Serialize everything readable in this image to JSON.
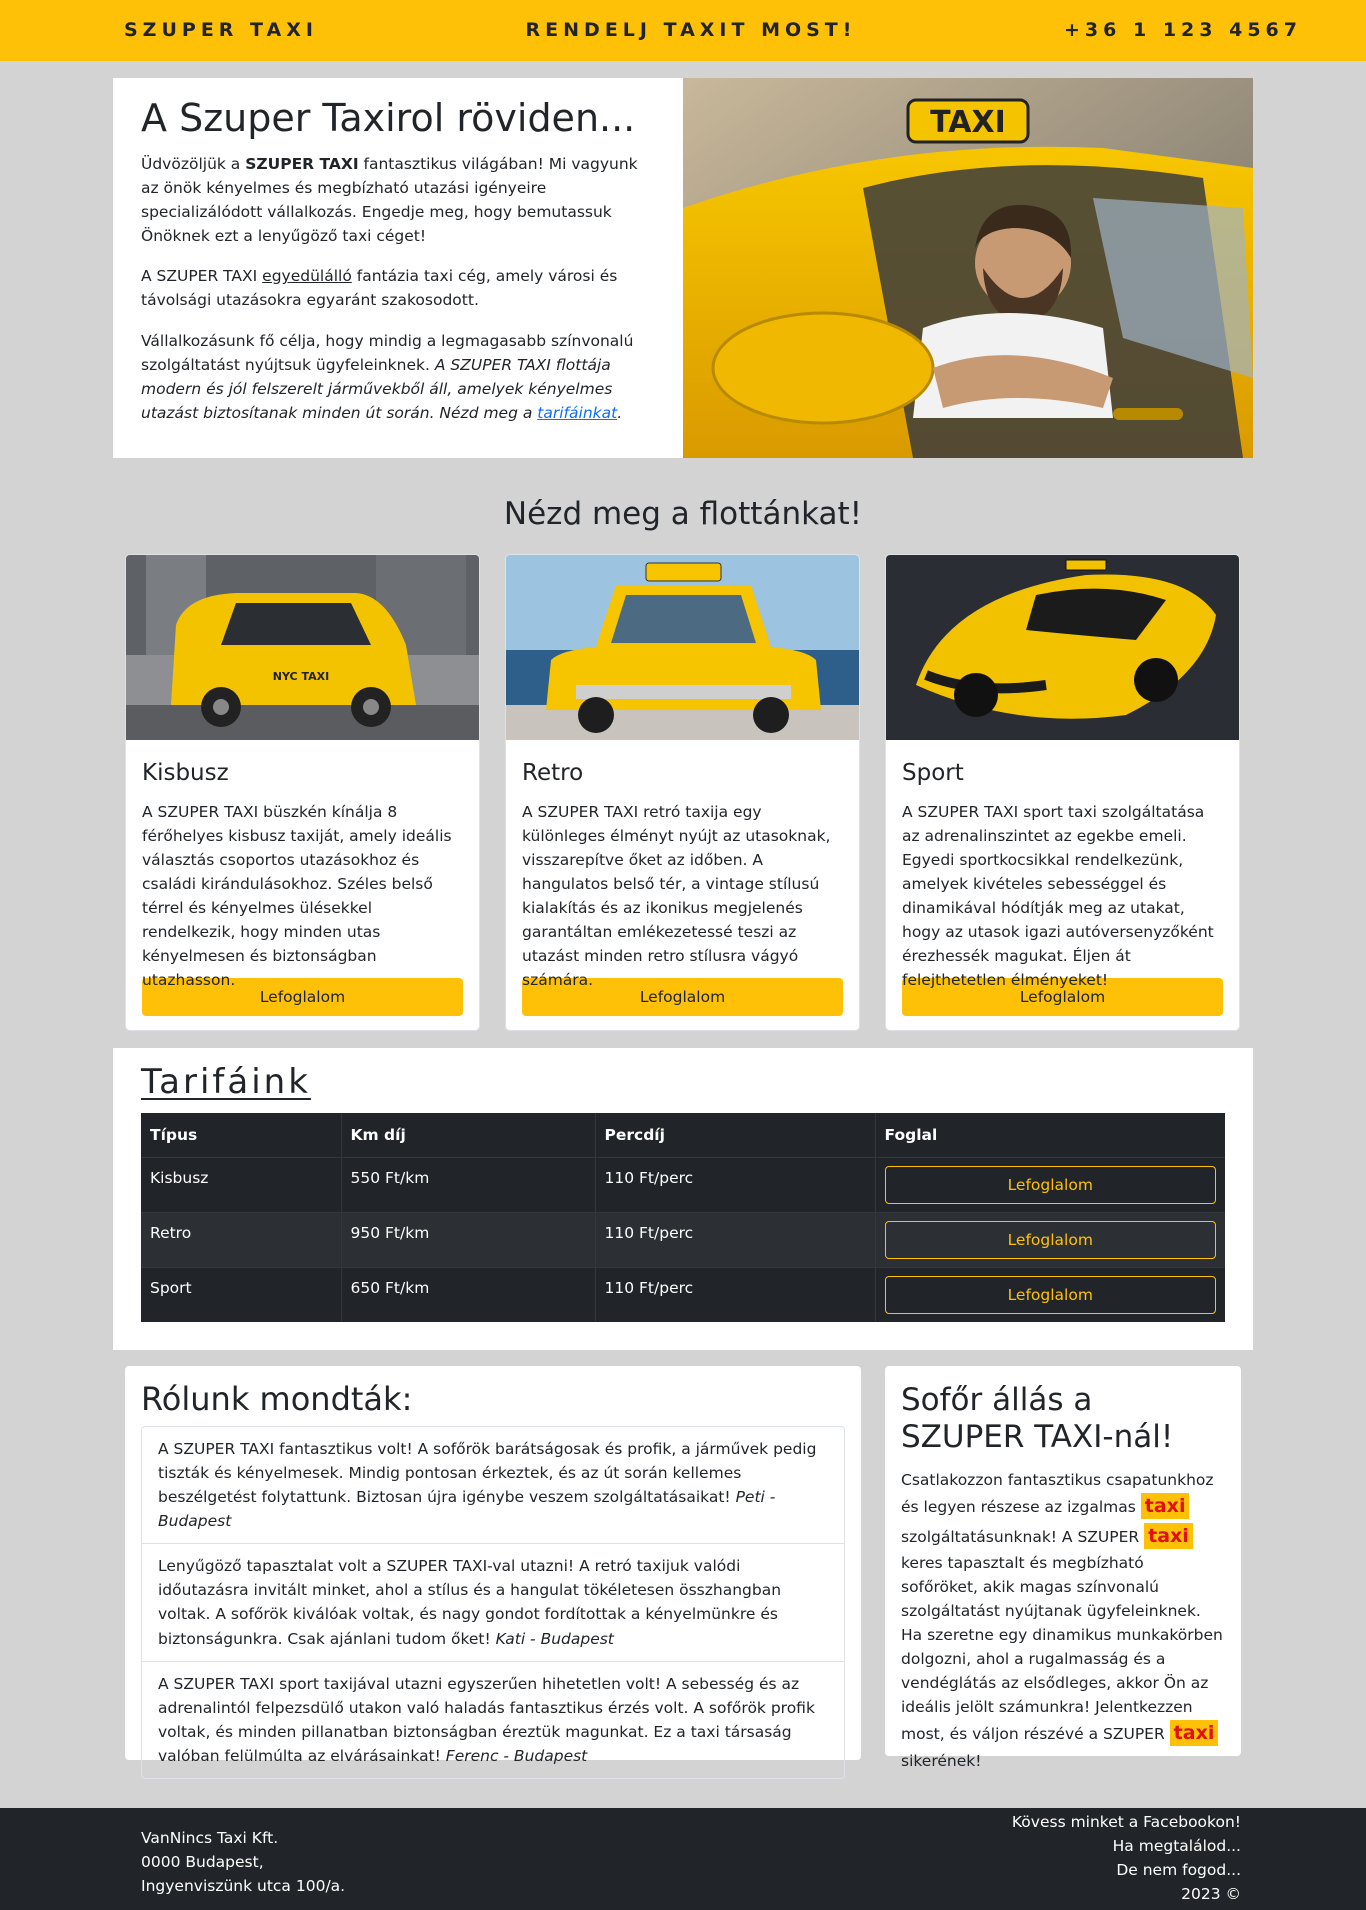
{
  "header": {
    "brand": "SZUPER TAXI",
    "cta": "RENDELJ TAXIT MOST!",
    "phone": "+36 1 123 4567"
  },
  "intro": {
    "title": "A Szuper Taxirol röviden...",
    "p1_a": "Üdvözöljük a ",
    "p1_b": "SZUPER TAXI",
    "p1_c": " fantasztikus világában! Mi vagyunk az önök kényelmes és megbízható utazási igényeire specializálódott vállalkozás. Engedje meg, hogy bemutassuk Önöknek ezt a lenyűgöző taxi céget!",
    "p2_a": "A SZUPER TAXI ",
    "p2_b": "egyedülálló",
    "p2_c": " fantázia taxi cég, amely városi és távolsági utazásokra egyaránt szakosodott.",
    "p3_a": "Vállalkozásunk fő célja, hogy mindig a legmagasabb színvonalú szolgáltatást nyújtsuk ügyfeleinknek. ",
    "p3_b": "A SZUPER TAXI flottája modern és jól felszerelt járművekből áll, amelyek kényelmes utazást biztosítanak minden út során. Nézd meg a ",
    "p3_link": "tarifáinkat",
    "p3_c": "."
  },
  "fleet_title": "Nézd meg a flottánkat!",
  "cards": [
    {
      "title": "Kisbusz",
      "text": "A SZUPER TAXI büszkén kínálja 8 férőhelyes kisbusz taxiját, amely ideális választás csoportos utazásokhoz és családi kirándulásokhoz. Széles belső térrel és kényelmes ülésekkel rendelkezik, hogy minden utas kényelmesen és biztonságban utazhasson.",
      "button": "Lefoglalom"
    },
    {
      "title": "Retro",
      "text": "A SZUPER TAXI retró taxija egy különleges élményt nyújt az utasoknak, visszarepítve őket az időben. A hangulatos belső tér, a vintage stílusú kialakítás és az ikonikus megjelenés garantáltan emlékezetessé teszi az utazást minden retro stílusra vágyó számára.",
      "button": "Lefoglalom"
    },
    {
      "title": "Sport",
      "text": "A SZUPER TAXI sport taxi szolgáltatása az adrenalinszintet az egekbe emeli. Egyedi sportkocsikkal rendelkezünk, amelyek kivételes sebességgel és dinamikával hódítják meg az utakat, hogy az utasok igazi autóversenyzőként érezhessék magukat. Éljen át felejthetetlen élményeket!",
      "button": "Lefoglalom"
    }
  ],
  "tariffs": {
    "title": "Tarifáink",
    "headers": [
      "Típus",
      "Km díj",
      "Percdíj",
      "Foglal"
    ],
    "rows": [
      {
        "type": "Kisbusz",
        "km": "550 Ft/km",
        "min": "110 Ft/perc",
        "button": "Lefoglalom"
      },
      {
        "type": "Retro",
        "km": "950 Ft/km",
        "min": "110 Ft/perc",
        "button": "Lefoglalom"
      },
      {
        "type": "Sport",
        "km": "650 Ft/km",
        "min": "110 Ft/perc",
        "button": "Lefoglalom"
      }
    ]
  },
  "reviews": {
    "title": "Rólunk mondták:",
    "items": [
      {
        "text": "A SZUPER TAXI fantasztikus volt! A sofőrök barátságosak és profik, a járművek pedig tiszták és kényelmesek. Mindig pontosan érkeztek, és az út során kellemes beszélgetést folytattunk. Biztosan újra igénybe veszem szolgáltatásaikat! ",
        "author": "Peti - Budapest"
      },
      {
        "text": "Lenyűgöző tapasztalat volt a SZUPER TAXI-val utazni! A retró taxijuk valódi időutazásra invitált minket, ahol a stílus és a hangulat tökéletesen összhangban voltak. A sofőrök kiválóak voltak, és nagy gondot fordítottak a kényelmünkre és biztonságunkra. Csak ajánlani tudom őket! ",
        "author": "Kati - Budapest"
      },
      {
        "text": "A SZUPER TAXI sport taxijával utazni egyszerűen hihetetlen volt! A sebesség és az adrenalintól felpezsdülő utakon való haladás fantasztikus érzés volt. A sofőrök profik voltak, és minden pillanatban biztonságban éreztük magunkat. Ez a taxi társaság valóban felülmúlta az elvárásainkat! ",
        "author": "Ferenc - Budapest"
      }
    ]
  },
  "job": {
    "title": "Sofőr állás a SZUPER TAXI-nál!",
    "t1": "Csatlakozzon fantasztikus csapatunkhoz és legyen részese az izgalmas ",
    "hl": "taxi",
    "t2": " szolgáltatásunknak! A SZUPER ",
    "t3": " keres tapasztalt és megbízható sofőröket, akik magas színvonalú szolgáltatást nyújtanak ügyfeleinknek. Ha szeretne egy dinamikus munkakörben dolgozni, ahol a rugalmasság és a vendéglátás az elsődleges, akkor Ön az ideális jelölt számunkra! Jelentkezzen most, és váljon részévé a SZUPER ",
    "t4": " sikerének!"
  },
  "footer": {
    "company": "VanNincs Taxi Kft.",
    "city": "0000 Budapest,",
    "street": "Ingyenviszünk utca 100/a.",
    "fb": "Kövess minket a Facebookon!",
    "line2": "Ha megtalálod...",
    "line3": "De nem fogod...",
    "year": "2023 ©"
  },
  "colors": {
    "accent": "#ffc107",
    "background": "#d3d3d3",
    "dark": "#212529",
    "highlight_text": "#e01010"
  }
}
